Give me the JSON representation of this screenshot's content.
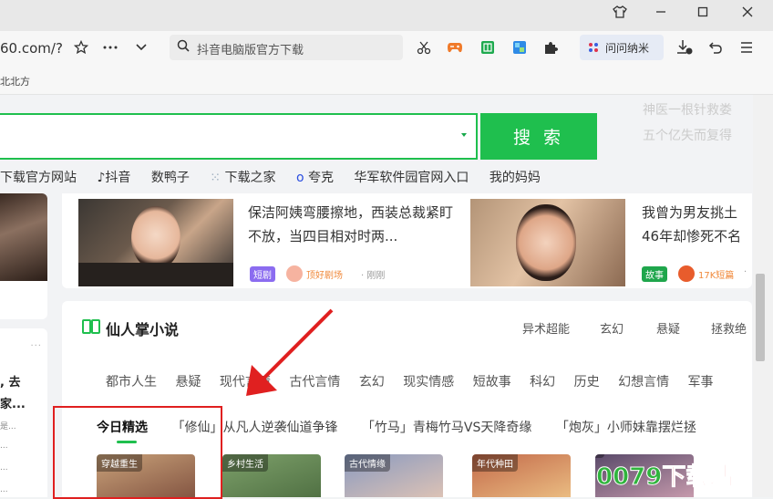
{
  "browser": {
    "url_partial": "60.com/?",
    "search_placeholder": "抖音电脑版官方下载",
    "wenwen_label": "问问纳米",
    "bookmark_partial": "北北方",
    "window_icons": [
      "shirt-icon",
      "minimize-icon",
      "maximize-icon",
      "close-icon"
    ],
    "toolbar_icons": [
      "star-icon",
      "more-icon",
      "chevron-down-icon",
      "scissors-icon",
      "game-icon",
      "book-icon",
      "photo-icon",
      "puzzle-icon",
      "download-icon",
      "undo-icon",
      "menu-icon"
    ]
  },
  "page": {
    "search_button": "搜 索",
    "right_top_lines": [
      "神医一根针救娄",
      "五个亿失而复得"
    ],
    "quick_links": [
      "下载官方网站",
      "抖音",
      "数鸭子",
      "下载之家",
      "夸克",
      "华军软件园官网入口",
      "我的妈妈"
    ],
    "news": [
      {
        "title": "保洁阿姨弯腰擦地，西装总裁紧盯不放，当四目相对时两...",
        "tag": "短剧",
        "source": "顶好剧场",
        "time": "· 刚刚"
      },
      {
        "title": "我曾为男友挑土46年却惨死不名",
        "tag": "故事",
        "source": "17K短篇",
        "time": "·"
      }
    ],
    "left_column": {
      "dots": "···",
      "lines": [
        ", 去",
        "家..."
      ],
      "small": [
        "是...",
        "...",
        "...",
        "..."
      ]
    },
    "novel": {
      "title": "仙人掌小说",
      "top_categories": [
        "异术超能",
        "玄幻",
        "悬疑",
        "拯救绝"
      ],
      "categories": [
        "都市人生",
        "悬疑",
        "现代言情",
        "古代言情",
        "玄幻",
        "现实情感",
        "短故事",
        "科幻",
        "历史",
        "幻想言情",
        "军事"
      ],
      "tabs": [
        "今日精选",
        "「修仙」从凡人逆袭仙道争锋",
        "「竹马」青梅竹马VS天降奇缘",
        "「炮灰」小师妹靠摆烂拯"
      ],
      "book_labels": [
        "穿越重生",
        "乡村生活",
        "古代情缘",
        "年代种田",
        ""
      ]
    },
    "watermark": {
      "green": "0079",
      "red": "下载站"
    }
  }
}
